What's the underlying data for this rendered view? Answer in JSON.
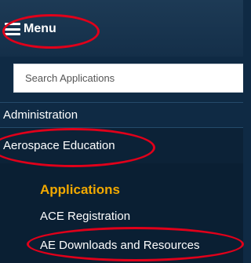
{
  "menu": {
    "label": "Menu"
  },
  "search": {
    "placeholder": "Search Applications"
  },
  "nav": {
    "administration": "Administration",
    "aerospace_education": "Aerospace Education"
  },
  "submenu": {
    "heading": "Applications",
    "items": [
      "ACE Registration",
      "AE Downloads and Resources"
    ]
  },
  "colors": {
    "background": "#0f2a44",
    "accent": "#f2a900",
    "highlight_ring": "#e0001a"
  }
}
